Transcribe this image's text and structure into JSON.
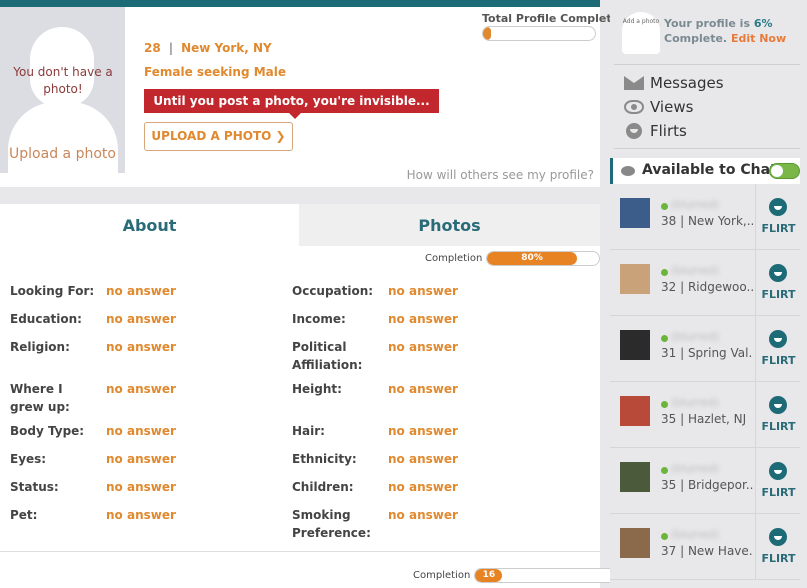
{
  "header": {
    "photo_placeholder_text": "You don't have a photo!",
    "upload_link": "Upload a photo",
    "age": "28",
    "location": "New York, NY",
    "seeking": "Female seeking Male",
    "invisible_banner": "Until you post a photo, you're invisible...",
    "upload_button": "UPLOAD A PHOTO ❯",
    "total_completion_label": "Total Profile Completion",
    "total_completion_pct": 6,
    "how_others_see": "How will others see my profile?"
  },
  "tabs": [
    {
      "label": "About",
      "active": true
    },
    {
      "label": "Photos",
      "active": false
    }
  ],
  "about": {
    "completion_label": "Completion",
    "completion_pct": 80,
    "completion_text": "80%",
    "fields_left": [
      {
        "label": "Looking For:",
        "value": "no answer"
      },
      {
        "label": "Education:",
        "value": "no answer"
      },
      {
        "label": "Religion:",
        "value": "no answer"
      },
      {
        "label": "Where I grew up:",
        "value": "no answer"
      },
      {
        "label": "Body Type:",
        "value": "no answer"
      },
      {
        "label": "Eyes:",
        "value": "no answer"
      },
      {
        "label": "Status:",
        "value": "no answer"
      },
      {
        "label": "Pet:",
        "value": "no answer"
      }
    ],
    "fields_right": [
      {
        "label": "Occupation:",
        "value": "no answer"
      },
      {
        "label": "Income:",
        "value": "no answer"
      },
      {
        "label": "Political Affiliation:",
        "value": "no answer"
      },
      {
        "label": "Height:",
        "value": "no answer"
      },
      {
        "label": "Hair:",
        "value": "no answer"
      },
      {
        "label": "Ethnicity:",
        "value": "no answer"
      },
      {
        "label": "Children:",
        "value": "no answer"
      },
      {
        "label": "Smoking Preference:",
        "value": "no answer"
      }
    ]
  },
  "footer": {
    "completion_label": "Completion",
    "completion_pct": 16,
    "completion_text": "16"
  },
  "sidebar": {
    "avatar_text": "Add a photo",
    "profile_is": "Your profile is",
    "profile_pct": "6%",
    "complete": "Complete.",
    "edit_now": "Edit Now",
    "nav": [
      {
        "label": "Messages",
        "icon": "envelope-icon"
      },
      {
        "label": "Views",
        "icon": "eye-icon"
      },
      {
        "label": "Flirts",
        "icon": "smiley-icon"
      }
    ],
    "chat_title": "Available to Chat",
    "chat_toggle_on": true,
    "flirt_label": "FLIRT",
    "users": [
      {
        "name": "(blurred)",
        "info": "38 | New York,..."
      },
      {
        "name": "(blurred)",
        "info": "32 | Ridgewoo..."
      },
      {
        "name": "(blurred)",
        "info": "31 | Spring Val..."
      },
      {
        "name": "(blurred)",
        "info": "35 | Hazlet, NJ"
      },
      {
        "name": "(blurred)",
        "info": "35 | Bridgepor..."
      },
      {
        "name": "(blurred)",
        "info": "37 | New Have..."
      }
    ]
  },
  "colors": {
    "brand_teal": "#1e6b78",
    "accent_orange": "#e0892f",
    "banner_red": "#c1272d",
    "online_green": "#6bb53a"
  }
}
